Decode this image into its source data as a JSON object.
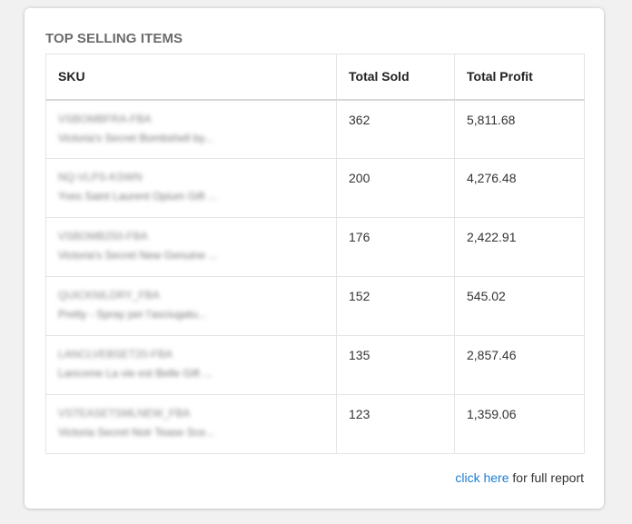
{
  "widget": {
    "title": "TOP SELLING ITEMS",
    "columns": [
      "SKU",
      "Total Sold",
      "Total Profit"
    ],
    "rows": [
      {
        "sku": "VSBOMBFRA-FBA",
        "description": "Victoria's Secret Bombshell by...",
        "total_sold": "362",
        "total_profit": "5,811.68"
      },
      {
        "sku": "NQ-VLPS-KSWN",
        "description": "Yves Saint Laurent Opium Gift ...",
        "total_sold": "200",
        "total_profit": "4,276.48"
      },
      {
        "sku": "VSBOMB250-FBA",
        "description": "Victoria's Secret New Genuine ...",
        "total_sold": "176",
        "total_profit": "2,422.91"
      },
      {
        "sku": "QUICKNILDRY_FBA",
        "description": "Pretty - Spray per l'asciugatu...",
        "total_sold": "152",
        "total_profit": "545.02"
      },
      {
        "sku": "LANCLVEBSET20-FBA",
        "description": "Lancome La vie est Belle Gift ...",
        "total_sold": "135",
        "total_profit": "2,857.46"
      },
      {
        "sku": "VSTEASETSMLNEW_FBA",
        "description": "Victoria Secret Noir Tease Sce...",
        "total_sold": "123",
        "total_profit": "1,359.06"
      }
    ],
    "footer": {
      "link_text": "click here",
      "suffix_text": " for full report"
    }
  }
}
